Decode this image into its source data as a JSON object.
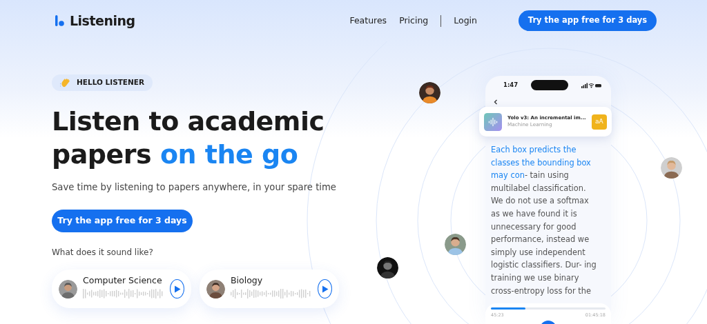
{
  "brand": {
    "name": "Listening"
  },
  "nav": {
    "links": [
      {
        "label": "Features"
      },
      {
        "label": "Pricing"
      },
      {
        "label": "Login"
      }
    ],
    "cta": "Try the app free for 3 days"
  },
  "hero": {
    "badge": "HELLO LISTENER",
    "title": "Listen to academic papers",
    "title_highlight": "on the go",
    "subtitle": "Save time by listening to papers anywhere, in your spare time",
    "cta": "Try the app free for 3 days",
    "samples_prompt": "What does it sound like?",
    "samples": [
      {
        "label": "Computer Science"
      },
      {
        "label": "Biology"
      }
    ]
  },
  "phone": {
    "time": "1:47",
    "paper": {
      "title": "Yolo v3: An incremental im...",
      "category": "Machine Learning",
      "font_button": "aA"
    },
    "text_read": "Each box predicts the classes the bounding box may con",
    "text_unread": "- tain using multilabel classification. We do not use a softmax as we have found it is unnecessary for good performance, instead we simply use independent logistic classifiers. Dur- ing training we use binary cross-entropy loss for the",
    "player": {
      "level": 0.3,
      "elapsed": "45:23",
      "total": "01:45:18"
    }
  }
}
